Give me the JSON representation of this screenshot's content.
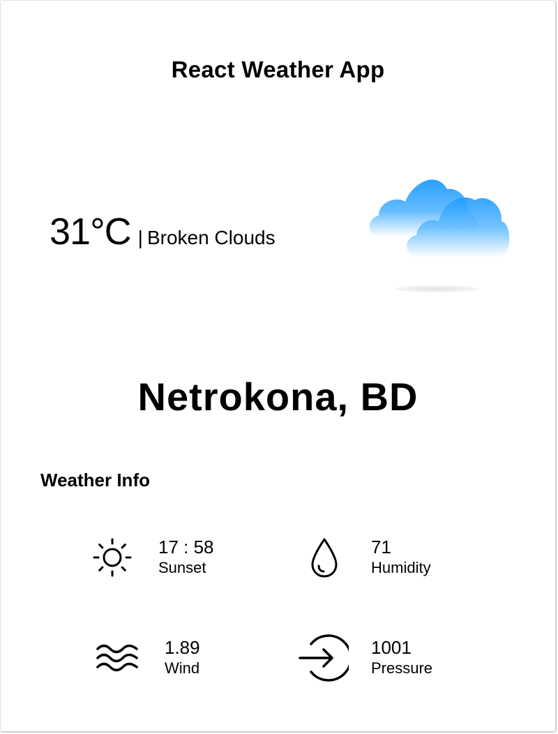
{
  "app": {
    "title": "React Weather App"
  },
  "current": {
    "temperature": "31°C",
    "separator": "|",
    "description": "Broken Clouds",
    "icon": "broken-clouds-icon"
  },
  "location": {
    "city": "Netrokona, BD"
  },
  "weather_info": {
    "title": "Weather Info",
    "items": [
      {
        "icon": "sun-icon",
        "value": "17 : 58",
        "label": "Sunset"
      },
      {
        "icon": "water-drop-icon",
        "value": "71",
        "label": "Humidity"
      },
      {
        "icon": "wind-waves-icon",
        "value": "1.89",
        "label": "Wind"
      },
      {
        "icon": "pressure-arrow-icon",
        "value": "1001",
        "label": "Pressure"
      }
    ]
  },
  "colors": {
    "cloud_top": "#2ea0ff",
    "cloud_bottom": "#ffffff",
    "text": "#000000"
  }
}
